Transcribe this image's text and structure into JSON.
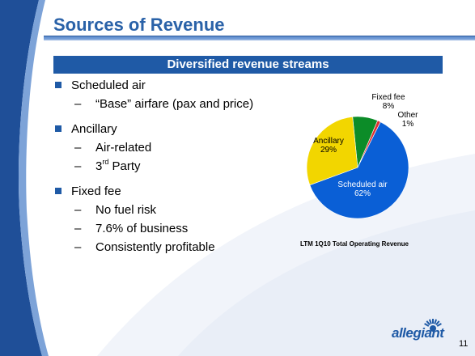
{
  "slide": {
    "title": "Sources of Revenue",
    "section_banner": "Diversified revenue streams",
    "page_number": "11",
    "logo_text": "allegiant"
  },
  "bullets": [
    {
      "text": "Scheduled air",
      "subs": [
        "“Base” airfare (pax and price)"
      ]
    },
    {
      "text": "Ancillary",
      "subs": [
        "Air-related",
        "3rd Party"
      ]
    },
    {
      "text": "Fixed fee",
      "subs": [
        "No fuel risk",
        "7.6% of business",
        "Consistently profitable"
      ]
    }
  ],
  "third_party": {
    "base": "3",
    "sup": "rd",
    "rest": " Party"
  },
  "chart_data": {
    "type": "pie",
    "title": "LTM 1Q10 Total Operating Revenue",
    "slices": [
      {
        "label": "Scheduled air",
        "value": 62,
        "value_label": "62%",
        "color": "#0a5fd6"
      },
      {
        "label": "Ancillary",
        "value": 29,
        "value_label": "29%",
        "color": "#f2d600"
      },
      {
        "label": "Fixed fee",
        "value": 8,
        "value_label": "8%",
        "color": "#0c8c28"
      },
      {
        "label": "Other",
        "value": 1,
        "value_label": "1%",
        "color": "#e03030"
      }
    ],
    "legend": "none",
    "data_labels": "category name and percent"
  },
  "colors": {
    "title": "#2a62a8",
    "banner_bg": "#1f5aa6",
    "bullet_square": "#1f5aa6",
    "background_swoosh": "#e8eef8"
  },
  "icons": {
    "logo": "allegiant-sun-logo"
  }
}
